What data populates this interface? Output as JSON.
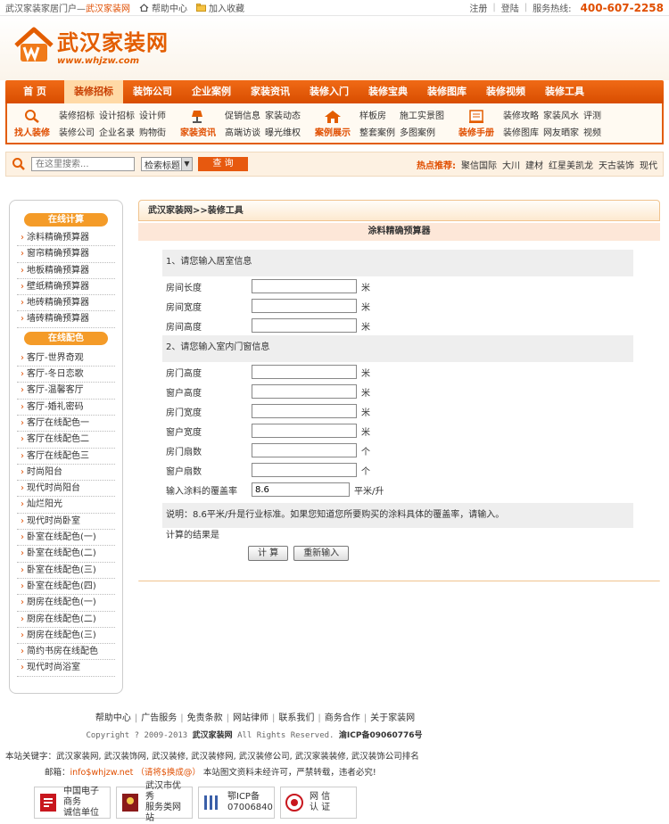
{
  "topbar": {
    "site_intro": "武汉家装家居门户—",
    "site_name": "武汉家装网",
    "help": "帮助中心",
    "favorite": "加入收藏",
    "register": "注册",
    "login": "登陆",
    "hotline_label": "服务热线:",
    "hotline": "400-607-2258"
  },
  "logo": {
    "cn": "武汉家装网",
    "en": "www.whjzw.com"
  },
  "nav": [
    "首 页",
    "装修招标",
    "装饰公司",
    "企业案例",
    "家装资讯",
    "装修入门",
    "装修宝典",
    "装修图库",
    "装修视频",
    "装修工具"
  ],
  "nav_active": 1,
  "subnav": [
    {
      "icon": "search-icon",
      "label": "找人装修",
      "links": [
        "装修招标",
        "设计招标",
        "设计师",
        "装修公司",
        "企业名录",
        "购物街"
      ]
    },
    {
      "icon": "lamp-icon",
      "label": "家装资讯",
      "links": [
        "促销信息",
        "家装动态",
        "高端访谈",
        "曝光维权"
      ]
    },
    {
      "icon": "house-icon",
      "label": "案例展示",
      "links": [
        "样板房",
        "施工实景图",
        "整套案例",
        "多图案例"
      ]
    },
    {
      "icon": "book-icon",
      "label": "装修手册",
      "links": [
        "装修攻略",
        "家装风水",
        "评测",
        "装修图库",
        "网友晒家",
        "视频"
      ]
    }
  ],
  "search": {
    "placeholder": "在这里搜索...",
    "select": "检索标题",
    "button": "查 询",
    "hot_label": "热点推荐:",
    "hot": [
      "聚信国际",
      "大川",
      "建材",
      "红星美凯龙",
      "天古装饰",
      "现代"
    ]
  },
  "sidebar": {
    "head1": "在线计算",
    "calc": [
      "涂料精确预算器",
      "窗帘精确预算器",
      "地板精确预算器",
      "壁纸精确预算器",
      "地砖精确预算器",
      "墙砖精确预算器"
    ],
    "head2": "在线配色",
    "colors": [
      "客厅-世界奇观",
      "客厅-冬日恋歌",
      "客厅-温馨客厅",
      "客厅-婚礼密码",
      "客厅在线配色一",
      "客厅在线配色二",
      "客厅在线配色三",
      "时尚阳台",
      "现代时尚阳台",
      "灿烂阳光",
      "现代时尚卧室",
      "卧室在线配色(一)",
      "卧室在线配色(二)",
      "卧室在线配色(三)",
      "卧室在线配色(四)",
      "厨房在线配色(一)",
      "厨房在线配色(二)",
      "厨房在线配色(三)",
      "简约书房在线配色",
      "现代时尚浴室"
    ]
  },
  "main": {
    "breadcrumb": "武汉家装网>>装修工具",
    "title": "涂料精确预算器",
    "sec1": "1、请您输入居室信息",
    "room": [
      {
        "label": "房间长度",
        "unit": "米"
      },
      {
        "label": "房间宽度",
        "unit": "米"
      },
      {
        "label": "房间高度",
        "unit": "米"
      }
    ],
    "sec2": "2、请您输入室内门窗信息",
    "doors": [
      {
        "label": "房门高度",
        "unit": "米"
      },
      {
        "label": "窗户高度",
        "unit": "米"
      },
      {
        "label": "房门宽度",
        "unit": "米"
      },
      {
        "label": "窗户宽度",
        "unit": "米"
      },
      {
        "label": "房门扇数",
        "unit": "个"
      },
      {
        "label": "窗户扇数",
        "unit": "个"
      }
    ],
    "coverage_label": "输入涂料的覆盖率",
    "coverage_value": "8.6",
    "coverage_unit": "平米/升",
    "note": "说明：8.6平米/升是行业标准。如果您知道您所要购买的涂料具体的覆盖率，请输入。",
    "result": "计算的结果是",
    "calc_btn": "计 算",
    "reset_btn": "重新输入"
  },
  "footer": {
    "links": [
      "帮助中心",
      "广告服务",
      "免责条款",
      "网站律师",
      "联系我们",
      "商务合作",
      "关于家装网"
    ],
    "copyright": "Copyright ? 2009-2013",
    "copyright_site": "武汉家装网",
    "copyright_rest": "All Rights Reserved.",
    "icp": "渝ICP备09060776号",
    "keywords": "本站关键字：武汉家装网, 武汉装饰网, 武汉装修, 武汉装修网, 武汉装修公司, 武汉家装装修, 武汉装饰公司排名",
    "mail_label": "邮箱：",
    "mail": "info$whjzw.net （请将$换成@）",
    "mail_notice": "本站图文资料未经许可，严禁转载，违者必究!",
    "badges": [
      {
        "l1": "中国电子商务",
        "l2": "诚信单位"
      },
      {
        "l1": "武汉市优秀",
        "l2": "服务类网站"
      },
      {
        "l1": "鄂ICP备",
        "l2": "07006840"
      },
      {
        "l1": "网 信",
        "l2": "认 证"
      }
    ]
  },
  "colors": {
    "brand": "#e35d00",
    "nav": "#e7590f",
    "hot": "#e04e00"
  }
}
